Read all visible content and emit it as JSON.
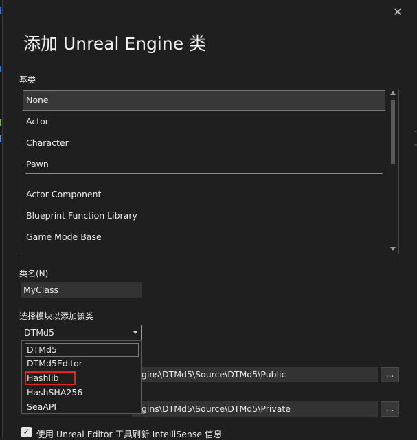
{
  "dialog": {
    "title": "添加 Unreal Engine 类",
    "close_glyph": "✕"
  },
  "base_class": {
    "label": "基类",
    "items": [
      {
        "label": "None",
        "selected": true
      },
      {
        "label": "Actor"
      },
      {
        "label": "Character"
      },
      {
        "label": "Pawn"
      },
      {
        "label": "Actor Component"
      },
      {
        "label": "Blueprint Function Library"
      },
      {
        "label": "Game Mode Base"
      }
    ]
  },
  "class_name": {
    "label": "类名(N)",
    "value": "MyClass"
  },
  "module": {
    "label": "选择模块以添加该类",
    "selected": "DTMd5",
    "options": [
      "DTMd5",
      "DTMd5Editor",
      "Hashlib",
      "HashSHA256",
      "SeaAPI"
    ],
    "highlighted": "Hashlib"
  },
  "paths": {
    "header_path": "ugins\\DTMd5\\Source\\DTMd5\\Public",
    "source_path": "ugins\\DTMd5\\Source\\DTMd5\\Private",
    "browse_label": "..."
  },
  "refresh_option": {
    "checked": true,
    "check_glyph": "✓",
    "label": "使用 Unreal Editor 工具刷新 IntelliSense 信息"
  },
  "colors": {
    "background": "#1f1f1f",
    "field": "#333333",
    "highlight_border": "#e02424"
  }
}
